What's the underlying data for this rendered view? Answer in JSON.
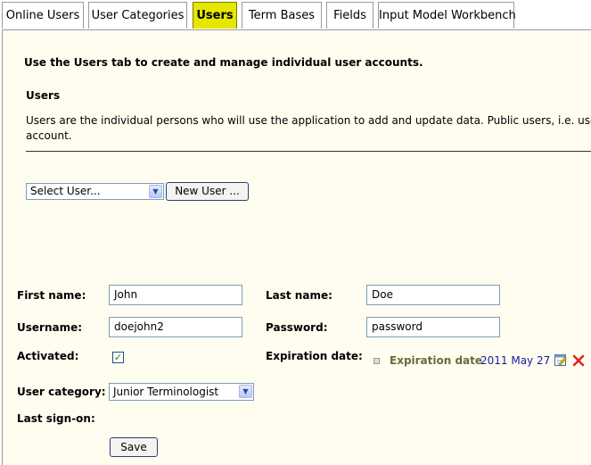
{
  "tabs": [
    {
      "label": "Online Users",
      "active": false
    },
    {
      "label": "User Categories",
      "active": false
    },
    {
      "label": "Users",
      "active": true
    },
    {
      "label": "Term Bases",
      "active": false
    },
    {
      "label": "Fields",
      "active": false
    },
    {
      "label": "Input Model Workbench",
      "active": false
    }
  ],
  "intro": "Use the Users tab to create and manage individual user accounts.",
  "section": {
    "heading": "Users",
    "description_line1": "Users are the individual persons who will use the application to add and update data. Public users, i.e. users w",
    "description_line2": "account."
  },
  "user_picker": {
    "select_value": "Select User...",
    "new_user_label": "New User ..."
  },
  "form": {
    "first_name_label": "First name:",
    "first_name_value": "John",
    "last_name_label": "Last name:",
    "last_name_value": "Doe",
    "username_label": "Username:",
    "username_value": "doejohn2",
    "password_label": "Password:",
    "password_value": "password",
    "activated_label": "Activated:",
    "activated_checked": true,
    "expiration_label": "Expiration date:",
    "expiration_field_label": "Expiration date",
    "expiration_value": "2011 May 27",
    "user_category_label": "User category:",
    "user_category_value": "Junior Terminologist",
    "last_signon_label": "Last sign-on:",
    "save_label": "Save"
  },
  "icons": {
    "select_arrow": "chevron-down-icon",
    "edit": "edit-calendar-icon",
    "clear": "red-x-icon"
  },
  "colors": {
    "active_tab": "#e6e600",
    "panel_background": "#fffdf0",
    "expiration_label": "#6b6b3a",
    "expiration_value": "#1a1aa0"
  }
}
